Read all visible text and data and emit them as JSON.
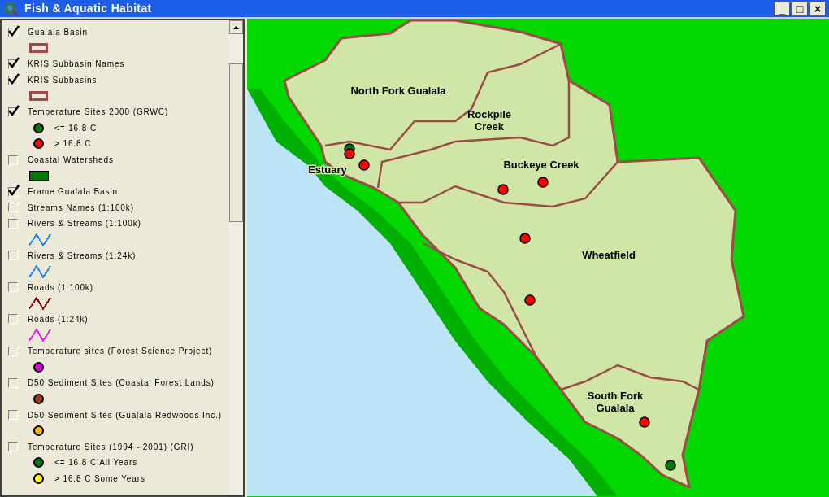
{
  "window": {
    "title": "Fish & Aquatic Habitat",
    "controls": [
      "_",
      "□",
      "×"
    ]
  },
  "legend": {
    "layers": [
      {
        "label": "Gualala Basin",
        "checked": true,
        "symbol": {
          "kind": "outline",
          "color": "#9c4a4a"
        }
      },
      {
        "label": "KRIS Subbasin Names",
        "checked": true
      },
      {
        "label": "KRIS Subbasins",
        "checked": true,
        "symbol": {
          "kind": "outline",
          "color": "#9c4a4a"
        }
      },
      {
        "label": "Temperature Sites 2000 (GRWC)",
        "checked": true,
        "classes": [
          {
            "label": "<= 16.8 C",
            "color": "#007800"
          },
          {
            "label": "> 16.8 C",
            "color": "#ff0000"
          }
        ]
      },
      {
        "label": "Coastal Watersheds",
        "checked": false,
        "symbol": {
          "kind": "fill",
          "color": "#007800"
        }
      },
      {
        "label": "Frame Gualala Basin",
        "checked": true
      },
      {
        "label": "Streams Names (1:100k)",
        "checked": false
      },
      {
        "label": "Rivers & Streams (1:100k)",
        "checked": false,
        "symbol": {
          "kind": "line",
          "color": "#2a8cf0"
        }
      },
      {
        "label": "Rivers & Streams (1:24k)",
        "checked": false,
        "symbol": {
          "kind": "line",
          "color": "#2a8cf0"
        }
      },
      {
        "label": "Roads (1:100k)",
        "checked": false,
        "symbol": {
          "kind": "line",
          "color": "#8b1010"
        }
      },
      {
        "label": "Roads (1:24k)",
        "checked": false,
        "symbol": {
          "kind": "line",
          "color": "#f020f0"
        }
      },
      {
        "label": "Temperature sites (Forest Science Project)",
        "checked": false,
        "symbol": {
          "kind": "dot",
          "color": "#e000e8"
        }
      },
      {
        "label": "D50 Sediment Sites (Coastal Forest Lands)",
        "checked": false,
        "symbol": {
          "kind": "dot",
          "color": "#a83c08"
        }
      },
      {
        "label": "D50 Sediment Sites (Gualala Redwoods Inc.)",
        "checked": false,
        "symbol": {
          "kind": "dot",
          "color": "#f8b800"
        }
      },
      {
        "label": "Temperature Sites (1994 - 2001) (GRI)",
        "checked": false,
        "classes": [
          {
            "label": "<= 16.8 C All Years",
            "color": "#007800"
          },
          {
            "label": "> 16.8 C Some Years",
            "color": "#ffff00"
          }
        ]
      }
    ]
  },
  "map": {
    "subbasin_labels": [
      "North Fork Gualala",
      "Rockpile Creek",
      "Estuary",
      "Buckeye Creek",
      "Wheatfield",
      "South Fork Gualala"
    ],
    "sites": [
      {
        "color": "#007800"
      },
      {
        "color": "#ff0000"
      },
      {
        "color": "#ff0000"
      },
      {
        "color": "#ff0000"
      },
      {
        "color": "#ff0000"
      },
      {
        "color": "#ff0000"
      },
      {
        "color": "#ff0000"
      },
      {
        "color": "#ff0000"
      },
      {
        "color": "#007800"
      }
    ]
  }
}
